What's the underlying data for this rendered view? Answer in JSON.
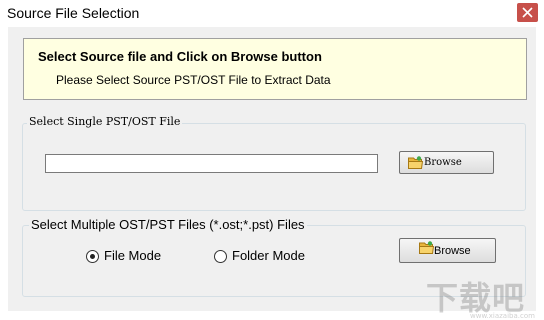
{
  "window": {
    "title": "Source File Selection"
  },
  "banner": {
    "title": "Select Source file and Click on Browse button",
    "subtitle": "Please Select Source PST/OST File to Extract Data"
  },
  "single_group": {
    "legend": "Select Single PST/OST File",
    "path_value": "",
    "browse_label": "Browse"
  },
  "multiple_group": {
    "legend": "Select Multiple OST/PST Files (*.ost;*.pst) Files",
    "file_mode_label": "File Mode",
    "folder_mode_label": "Folder Mode",
    "selected_mode": "File Mode",
    "browse_label": "Browse"
  },
  "watermark": {
    "text": "下载吧",
    "url": "www.xiazaiba.com"
  },
  "icons": [
    "close-icon",
    "folder-icon"
  ]
}
